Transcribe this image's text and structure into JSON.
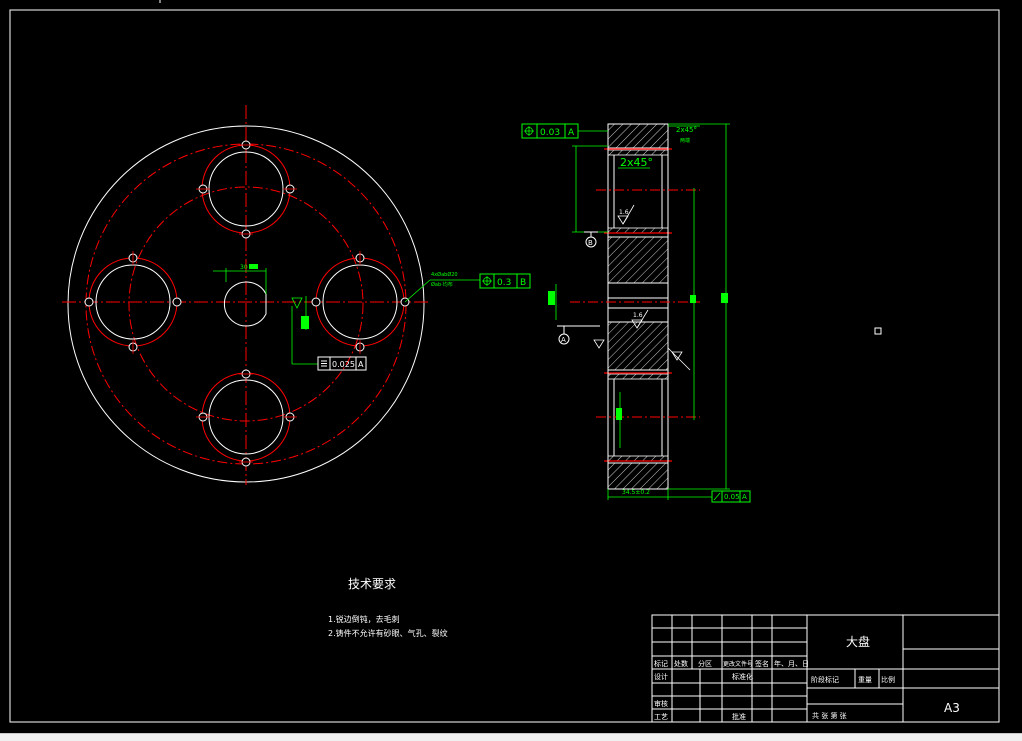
{
  "drawing": {
    "colors": {
      "background": "#000000",
      "outline": "#ffffff",
      "centerline": "#ff0000",
      "dimension": "#00ff00",
      "hatch": "#ffffff",
      "highlight": "#ff0000"
    },
    "front_view": {
      "dim_keyway_width": "30",
      "hole_note_line1": "4xØabØ20",
      "hole_note_line2": "Øab·均布",
      "position_tol_value": "0.3",
      "position_tol_datum": "B",
      "symmetry_tol_value": "0.025",
      "symmetry_tol_datum": "A"
    },
    "section_view": {
      "position_tol_value": "0.03",
      "position_tol_datum": "A",
      "chamfer_top": "2x45°",
      "chamfer_top_note": "两端",
      "chamfer_inner": "2x45°",
      "datum_b": "B",
      "datum_a": "A",
      "roughness_1": "1.6",
      "roughness_2": "1.6",
      "dim_width": "34.5±0.2",
      "runout_value": "0.05",
      "runout_datum": "A"
    },
    "tech_requirements": {
      "title": "技术要求",
      "items": [
        "1.锐边倒钝，去毛刺",
        "2.铸件不允许有砂眼、气孔、裂纹"
      ]
    },
    "title_block": {
      "part_name": "大盘",
      "sheet_size": "A3",
      "row_labels": [
        "标记",
        "处数",
        "分区",
        "更改文件号",
        "签名",
        "年、月、日"
      ],
      "designer": "设计",
      "standardize": "标准化",
      "review": "审核",
      "process": "工艺",
      "approve": "批准",
      "stage_mark": "阶段标记",
      "weight": "重量",
      "scale": "比例",
      "sheet_count": "共  张  第  张"
    }
  }
}
